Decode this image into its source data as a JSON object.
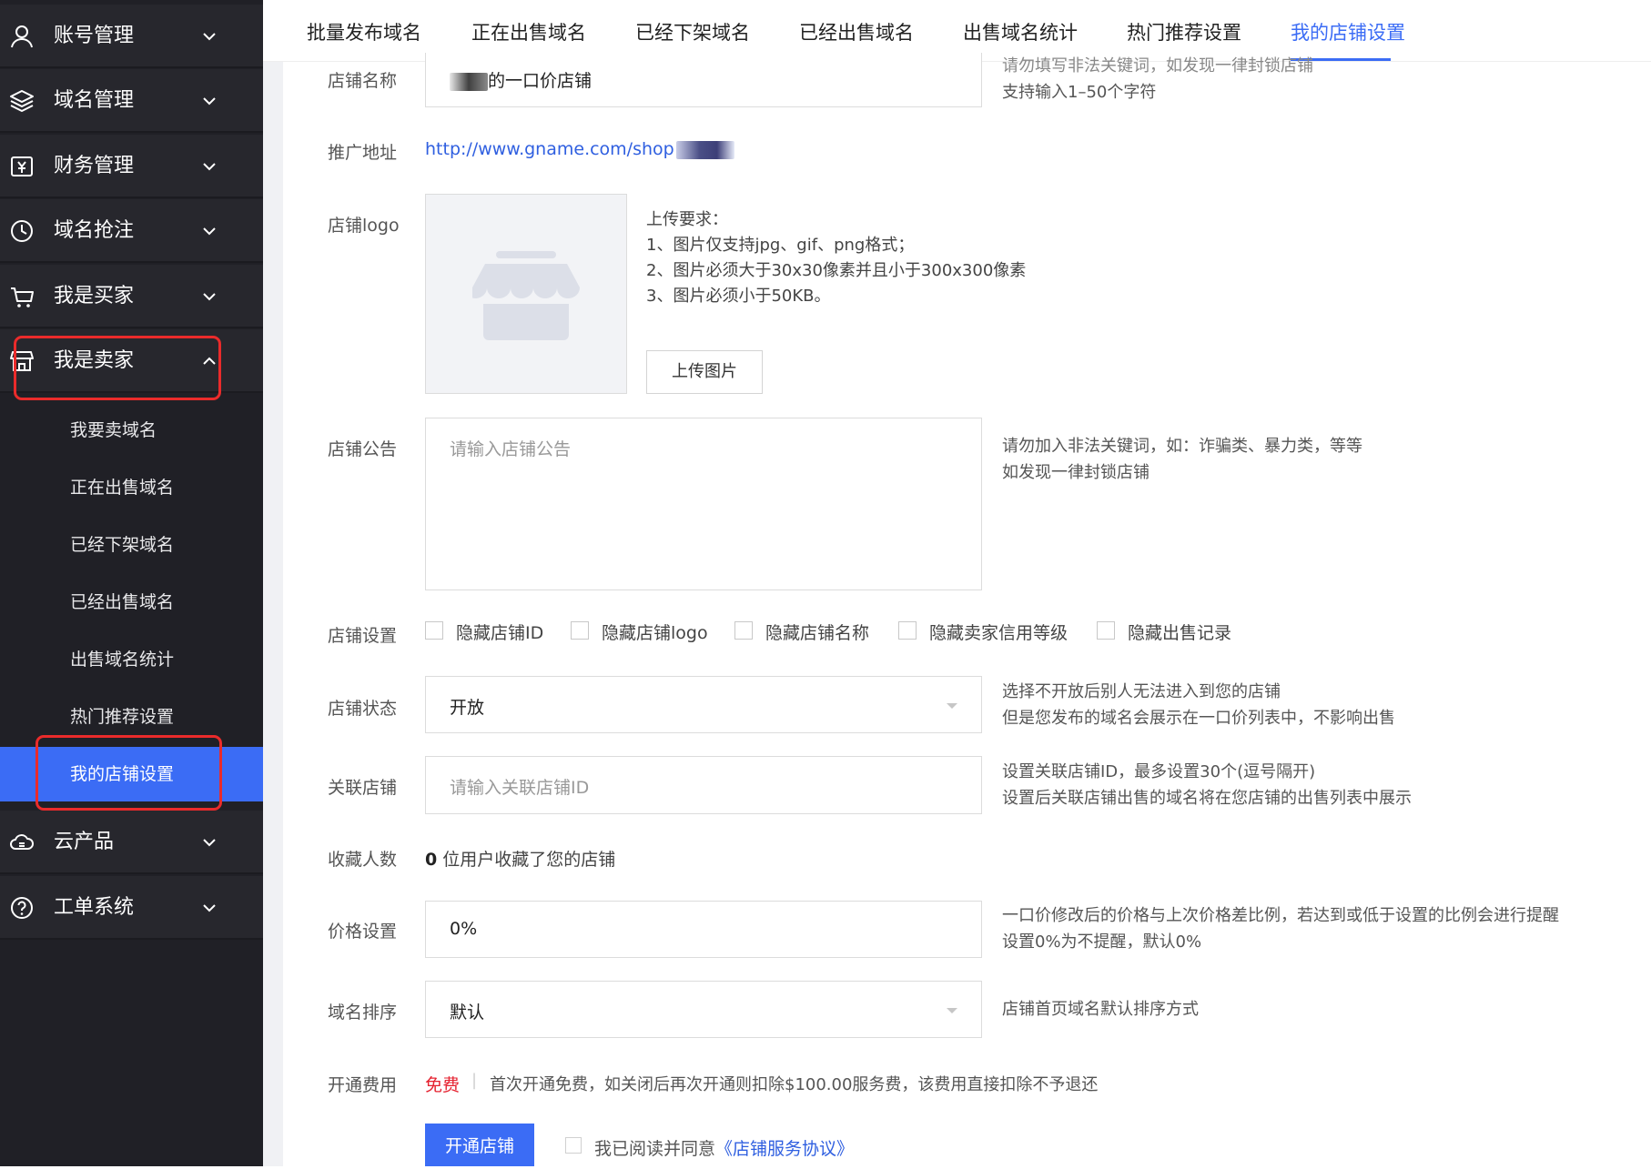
{
  "sidebar": {
    "menus": [
      {
        "label": "账号管理",
        "icon": "user-icon"
      },
      {
        "label": "域名管理",
        "icon": "layers-icon"
      },
      {
        "label": "财务管理",
        "icon": "finance-icon"
      },
      {
        "label": "域名抢注",
        "icon": "clock-icon"
      },
      {
        "label": "我是买家",
        "icon": "cart-icon"
      },
      {
        "label": "我是卖家",
        "icon": "store-icon"
      },
      {
        "label": "云产品",
        "icon": "cloud-icon"
      },
      {
        "label": "工单系统",
        "icon": "help-icon"
      }
    ],
    "seller_items": [
      "我要卖域名",
      "正在出售域名",
      "已经下架域名",
      "已经出售域名",
      "出售域名统计",
      "热门推荐设置",
      "我的店铺设置"
    ]
  },
  "tabs": [
    "批量发布域名",
    "正在出售域名",
    "已经下架域名",
    "已经出售域名",
    "出售域名统计",
    "热门推荐设置",
    "我的店铺设置"
  ],
  "form": {
    "shop_name": {
      "label": "店铺名称",
      "value": "的一口价店铺",
      "hint1": "请勿填写非法关键词，如发现一律封锁店铺",
      "hint2": "支持输入1–50个字符"
    },
    "promo_url": {
      "label": "推广地址",
      "value": "http://www.gname.com/shop"
    },
    "logo": {
      "label": "店铺logo",
      "req_title": "上传要求：",
      "req1": "1、图片仅支持jpg、gif、png格式；",
      "req2": "2、图片必须大于30x30像素并且小于300x300像素",
      "req3": "3、图片必须小于50KB。",
      "upload_label": "上传图片"
    },
    "notice": {
      "label": "店铺公告",
      "placeholder": "请输入店铺公告",
      "hint1": "请勿加入非法关键词，如：诈骗类、暴力类，等等",
      "hint2": "如发现一律封锁店铺"
    },
    "settings": {
      "label": "店铺设置",
      "options": [
        "隐藏店铺ID",
        "隐藏店铺logo",
        "隐藏店铺名称",
        "隐藏卖家信用等级",
        "隐藏出售记录"
      ]
    },
    "status": {
      "label": "店铺状态",
      "value": "开放",
      "hint1": "选择不开放后别人无法进入到您的店铺",
      "hint2": "但是您发布的域名会展示在一口价列表中，不影响出售"
    },
    "related": {
      "label": "关联店铺",
      "placeholder": "请输入关联店铺ID",
      "hint1": "设置关联店铺ID，最多设置30个(逗号隔开)",
      "hint2": "设置后关联店铺出售的域名将在您店铺的出售列表中展示"
    },
    "favorites": {
      "label": "收藏人数",
      "count": "0",
      "text": "位用户收藏了您的店铺"
    },
    "price": {
      "label": "价格设置",
      "value": "0%",
      "hint1": "一口价修改后的价格与上次价格差比例，若达到或低于设置的比例会进行提醒",
      "hint2": "设置0%为不提醒，默认0%"
    },
    "sort": {
      "label": "域名排序",
      "value": "默认",
      "hint": "店铺首页域名默认排序方式"
    },
    "fee": {
      "label": "开通费用",
      "free": "免费",
      "sep": "|",
      "text": "首次开通免费，如关闭后再次开通则扣除$100.00服务费，该费用直接扣除不予退还"
    },
    "open_button": "开通店铺",
    "agreement_text": "我已阅读并同意",
    "agreement_link": "《店铺服务协议》"
  },
  "colors": {
    "accent": "#3b6cf5",
    "sidebar_bg": "#202026",
    "highlight_box": "#ea2b2b",
    "free_text": "#e5212f"
  }
}
